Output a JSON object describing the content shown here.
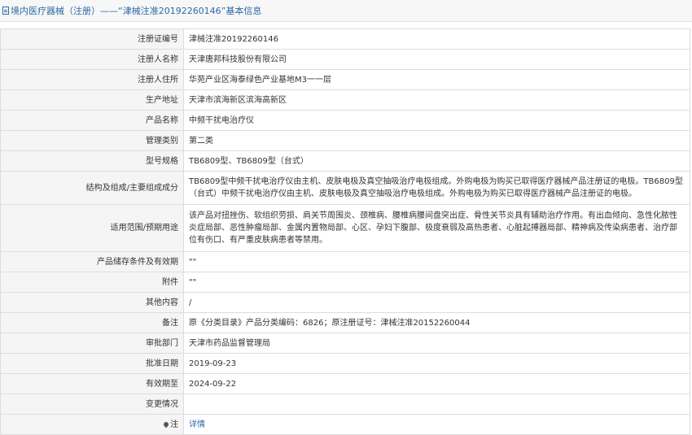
{
  "title": {
    "text": "境内医疗器械（注册）——“津械注准20192260146”基本信息",
    "icon": "document-icon",
    "color": "#2b6aa6"
  },
  "rows": [
    {
      "label": "注册证编号",
      "value": "津械注准20192260146"
    },
    {
      "label": "注册人名称",
      "value": "天津唐邦科技股份有限公司"
    },
    {
      "label": "注册人住所",
      "value": "华苑产业区海泰绿色产业基地M3一一层"
    },
    {
      "label": "生产地址",
      "value": "天津市滨海新区滨海高新区"
    },
    {
      "label": "产品名称",
      "value": "中频干扰电治疗仪"
    },
    {
      "label": "管理类别",
      "value": "第二类"
    },
    {
      "label": "型号规格",
      "value": "TB6809型、TB6809型（台式）"
    },
    {
      "label": "结构及组成/主要组成成分",
      "value": "TB6809型中频干扰电治疗仪由主机、皮肤电极及真空抽吸治疗电极组成。外购电极为购买已取得医疗器械产品注册证的电极。TB6809型（台式）中频干扰电治疗仪由主机、皮肤电极及真空抽吸治疗电极组成。外购电极为购买已取得医疗器械产品注册证的电极。"
    },
    {
      "label": "适用范围/预期用途",
      "value": "该产品对扭挫伤、软组织劳损、肩关节周围炎、颈椎病、腰椎病腰间盘突出症、骨性关节炎具有辅助治疗作用。有出血倾向、急性化脓性炎症局部、恶性肿瘤局部、金属内置物局部、心区、孕妇下腹部、极度衰弱及高热患者、心脏起搏器局部、精神病及传染病患者、治疗部位有伤口、有严重皮肤病患者等禁用。"
    },
    {
      "label": "产品储存条件及有效期",
      "value": "\"\""
    },
    {
      "label": "附件",
      "value": "\"\""
    },
    {
      "label": "其他内容",
      "value": "/"
    },
    {
      "label": "备注",
      "value": "原《分类目录》产品分类编码：6826；原注册证号：津械注准20152260044"
    },
    {
      "label": "审批部门",
      "value": "天津市药品监督管理局"
    },
    {
      "label": "批准日期",
      "value": "2019-09-23"
    },
    {
      "label": "有效期至",
      "value": "2024-09-22"
    },
    {
      "label": "变更情况",
      "value": ""
    }
  ],
  "note_row": {
    "label": "注",
    "icon": "pin-icon",
    "link_text": "详情",
    "link_color": "#2b6aa6"
  }
}
